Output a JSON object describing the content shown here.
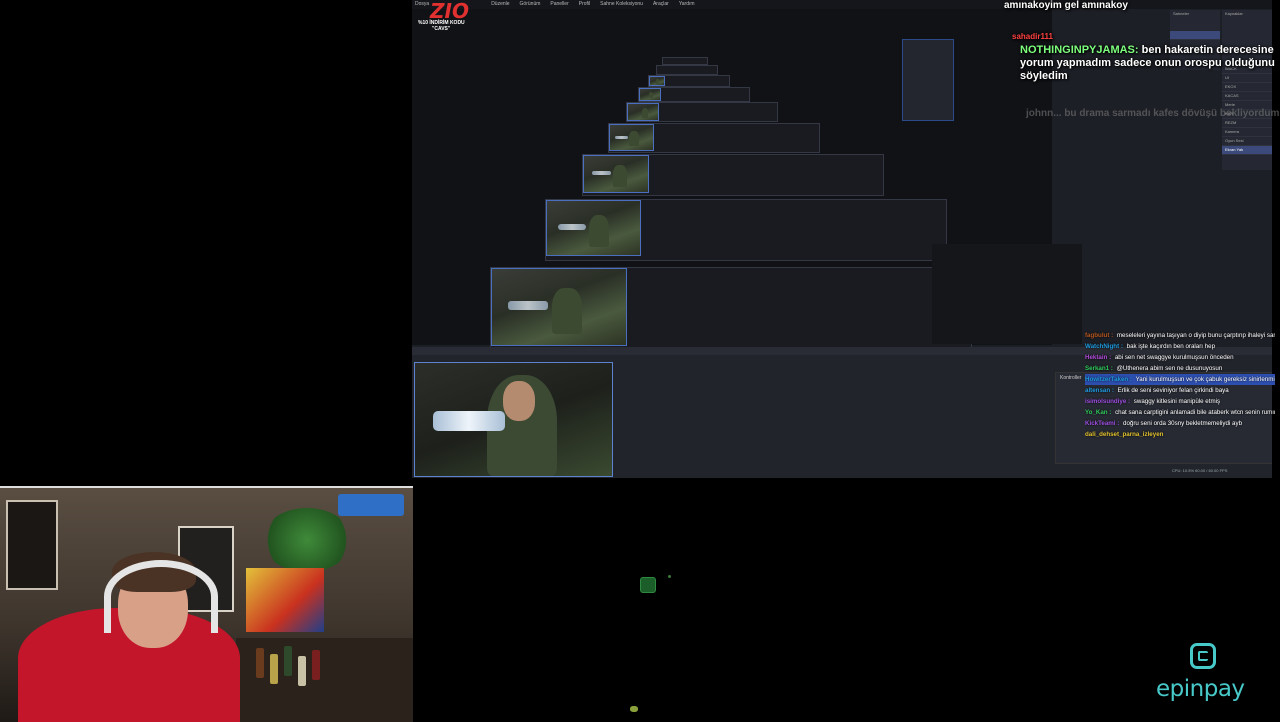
{
  "obs": {
    "menu": [
      "Dosya",
      "Düzenle",
      "Görünüm",
      "Paneller",
      "Profil",
      "Sahne Koleksiyonu",
      "Araçlar",
      "Yardım"
    ],
    "scenes_title": "Sahneler",
    "sources_title": "Kaynaklar",
    "sources": [
      "WACK",
      "UI",
      "EKOX",
      "KACAS",
      "Merle",
      "KAR",
      "REZM",
      "Kamera",
      "Oyun Sesi",
      "Ekran Yak"
    ],
    "controls_title": "Kontroller",
    "status": "CPU: 10.5%   60.00 / 60.00 FPS"
  },
  "logo": {
    "text": "ZIO",
    "sub1": "%10 İNDİRİM KODU",
    "sub2": "\"CAVS\""
  },
  "overlay_chat": {
    "line1": "amınakoyim gel amınakoy",
    "user": "NOTHINGINPYJAMAS:",
    "message": "ben hakaretin derecesine yorum yapmadım sadece onun orospu olduğunu söyledim",
    "faded": "johnn... bu drama sarmadı kafes dövüşü bekliyordum",
    "badge_user": "sahadir111"
  },
  "chat": [
    {
      "user": "fagbulut",
      "text": "meseleleri yayına taşıyan o diyip bunu çarptınp ihaleyi sana yıktı işte abi @cavs",
      "color": "#b5571f"
    },
    {
      "user": "WatchNight",
      "text": "bak işte kaçırdın ben oraları hep",
      "color": "#1e9be0"
    },
    {
      "user": "Hektain",
      "text": "abi sen net swaggye kurulmuşsun önceden",
      "color": "#b04ad8"
    },
    {
      "user": "Serkan1",
      "text": "@Uthenera abim sen ne dusunuyosun",
      "color": "#2ec95a"
    },
    {
      "user": "HowitzerTaken",
      "text": "Yani kurulmuşsun ve çok çabuk gereksiz sinirlenmişsin",
      "color": "#1e9be0"
    },
    {
      "user": "altensan",
      "text": "Erlik de seni seviniyor felan çirkindi baya",
      "color": "#1e9be0"
    },
    {
      "user": "isimolsundiye",
      "text": "swaggy kitlesini manipüle etmiş",
      "color": "#9d4de0"
    },
    {
      "user": "Yo_Kan",
      "text": "chat sana carptigini anlamadi bile ataberk wtcn senin rumını gecti ataberk azdı ama",
      "color": "#2ec95a"
    },
    {
      "user": "KickTeami",
      "text": "doğru seni orda 30sny bekletmemeliydi ayb",
      "color": "#9d4de0"
    },
    {
      "user": "dali_dehset_parna_izleyen",
      "text": "",
      "color": "#e0c02e"
    }
  ],
  "sponsor": {
    "name": "epinpay",
    "color": "#48c9c9"
  },
  "colors": {
    "accent": "#2d4fb0",
    "logo_red": "#e03030"
  }
}
